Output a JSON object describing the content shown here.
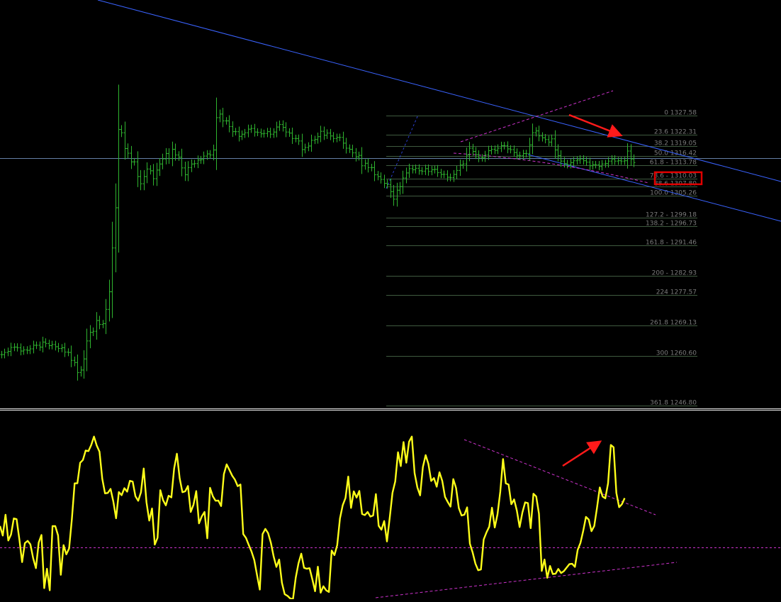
{
  "chart_data": [
    {
      "type": "ohlc",
      "panel": "price",
      "colors": {
        "bars": "#2fb52f",
        "trendlines": "#3a63ff",
        "channel": "#cc33cc",
        "fib_levels": "#3f5a3f",
        "fib_text": "#7a7a7a",
        "price_line": "#7f9fcf",
        "highlight_box": "#e00000",
        "arrow": "#ff1a1a"
      },
      "ylim": [
        1243,
        1335
      ],
      "fib_levels": [
        {
          "label": "0 1327.58",
          "value": 1327.58
        },
        {
          "label": "23.6 1322.31",
          "value": 1322.31
        },
        {
          "label": "38.2 1319.05",
          "value": 1319.05
        },
        {
          "label": "50.0 1316.42",
          "value": 1316.42
        },
        {
          "label": "61.8 - 1313.78",
          "value": 1313.78
        },
        {
          "label": "78.6 - 1310.03",
          "value": 1310.03
        },
        {
          "label": "88.6 1307.80",
          "value": 1307.8
        },
        {
          "label": "100.0 1305.26",
          "value": 1305.26
        },
        {
          "label": "127.2 - 1299.18",
          "value": 1299.18
        },
        {
          "label": "138.2 - 1296.73",
          "value": 1296.73
        },
        {
          "label": "161.8 - 1291.46",
          "value": 1291.46
        },
        {
          "label": "200 - 1282.93",
          "value": 1282.93
        },
        {
          "label": "224 1277.57",
          "value": 1277.57
        },
        {
          "label": "261.8 1269.13",
          "value": 1269.13
        },
        {
          "label": "300 1260.60",
          "value": 1260.6
        },
        {
          "label": "361.8 1246.80",
          "value": 1246.8
        }
      ],
      "highlighted_level": "78.6 - 1310.03",
      "current_price": 1315.7,
      "series_close": [
        1261.0,
        1261.6,
        1261.9,
        1263.0,
        1263.1,
        1262.9,
        1262.0,
        1262.3,
        1262.2,
        1262.6,
        1263.6,
        1263.6,
        1263.1,
        1264.5,
        1264.1,
        1263.5,
        1263.8,
        1263.2,
        1262.7,
        1262.9,
        1261.7,
        1261.6,
        1259.4,
        1258.8,
        1256.0,
        1256.7,
        1259.8,
        1264.8,
        1267.2,
        1267.5,
        1270.5,
        1269.4,
        1269.6,
        1273.6,
        1278.5,
        1290.7,
        1301.9,
        1323.7,
        1322.8,
        1318.4,
        1317.1,
        1314.7,
        1314.7,
        1310.6,
        1308.6,
        1310.6,
        1312.7,
        1312.2,
        1310.0,
        1312.4,
        1314.1,
        1315.5,
        1317.0,
        1315.6,
        1318.2,
        1316.6,
        1316.0,
        1313.0,
        1311.1,
        1313.1,
        1314.1,
        1314.2,
        1315.2,
        1315.3,
        1316.3,
        1316.9,
        1316.6,
        1318.0,
        1327.0,
        1328.0,
        1326.1,
        1326.1,
        1324.5,
        1323.1,
        1323.1,
        1321.8,
        1322.4,
        1322.8,
        1323.8,
        1324.0,
        1323.0,
        1322.9,
        1322.5,
        1322.6,
        1323.1,
        1322.4,
        1323.0,
        1324.4,
        1325.1,
        1324.3,
        1323.0,
        1322.7,
        1321.2,
        1321.2,
        1320.5,
        1318.1,
        1318.7,
        1319.1,
        1320.7,
        1320.9,
        1321.7,
        1323.2,
        1322.1,
        1322.7,
        1321.9,
        1321.2,
        1321.5,
        1321.5,
        1319.9,
        1318.5,
        1318.2,
        1317.2,
        1316.1,
        1316.5,
        1313.6,
        1314.3,
        1313.1,
        1313.1,
        1311.1,
        1310.6,
        1309.8,
        1308.7,
        1308.3,
        1306.4,
        1304.3,
        1306.8,
        1307.8,
        1310.2,
        1311.6,
        1312.8,
        1312.5,
        1312.9,
        1312.2,
        1312.1,
        1312.8,
        1312.0,
        1312.5,
        1312.6,
        1311.7,
        1311.2,
        1311.2,
        1310.4,
        1310.3,
        1311.2,
        1312.3,
        1313.8,
        1314.1,
        1316.6,
        1318.5,
        1317.6,
        1316.7,
        1315.8,
        1315.8,
        1316.6,
        1317.8,
        1318.2,
        1317.9,
        1318.5,
        1319.2,
        1319.2,
        1318.3,
        1318.1,
        1317.3,
        1316.5,
        1316.4,
        1317.0,
        1317.0,
        1319.4,
        1322.8,
        1323.3,
        1321.9,
        1321.4,
        1320.9,
        1320.2,
        1321.1,
        1318.0,
        1316.4,
        1314.9,
        1314.2,
        1313.9,
        1314.5,
        1315.0,
        1315.2,
        1315.5,
        1315.0,
        1314.6,
        1313.6,
        1313.9,
        1313.9,
        1313.4,
        1314.1,
        1314.2,
        1314.9,
        1315.5,
        1314.9,
        1315.0,
        1314.9,
        1315.0,
        1317.7,
        1315.5,
        1314.5
      ]
    },
    {
      "type": "line",
      "panel": "oscillator",
      "colors": {
        "line": "#ffff1a",
        "trendlines": "#cc33cc",
        "arrow": "#ff1a1a",
        "separator": "#e6e6e6"
      },
      "ylim": [
        0,
        100
      ],
      "midline": 28,
      "values": [
        39.7,
        34.5,
        45.8,
        31.8,
        35.1,
        43.8,
        43.4,
        32.5,
        20.1,
        30.4,
        31.6,
        29.7,
        22.2,
        16.8,
        30.7,
        34.8,
        6.0,
        16.5,
        4.8,
        39.6,
        39.6,
        34.6,
        13.2,
        29.3,
        24.3,
        27.5,
        43.4,
        62.8,
        62.9,
        74.0,
        75.5,
        80.6,
        80.3,
        83.6,
        88.2,
        83.3,
        80.0,
        65.3,
        57.4,
        57.6,
        59.8,
        53.0,
        43.9,
        58.1,
        56.4,
        60.2,
        58.3,
        64.2,
        63.8,
        55.8,
        53.4,
        58.0,
        70.9,
        52.5,
        42.6,
        49.2,
        29.6,
        33.3,
        59.1,
        53.7,
        50.9,
        56.1,
        55.2,
        70.9,
        78.9,
        65.6,
        58.0,
        58.5,
        61.4,
        47.3,
        51.2,
        58.6,
        41.1,
        44.9,
        47.3,
        33.0,
        60.4,
        55.8,
        53.4,
        53.5,
        50.5,
        67.8,
        73.1,
        70.1,
        67.0,
        64.8,
        61.3,
        62.2,
        35.3,
        33.2,
        29.4,
        25.8,
        21.2,
        13.0,
        5.2,
        35.3,
        38.1,
        35.8,
        30.6,
        23.2,
        17.5,
        21.5,
        8.9,
        2.7,
        1.8,
        0.4,
        0.0,
        11.7,
        19.5,
        24.7,
        17.0,
        16.5,
        16.8,
        10.8,
        4.3,
        17.6,
        3.5,
        7.0,
        4.8,
        3.9,
        26.4,
        23.9,
        29.3,
        43.8,
        51.0,
        54.9,
        66.5,
        49.5,
        58.5,
        55.1,
        58.7,
        46.2,
        45.6,
        47.3,
        44.8,
        45.4,
        57.0,
        39.8,
        37.7,
        42.4,
        31.3,
        44.1,
        57.7,
        63.9,
        79.7,
        72.2,
        85.2,
        74.0,
        85.4,
        88.2,
        68.4,
        60.6,
        56.3,
        71.7,
        78.1,
        73.3,
        64.1,
        65.7,
        61.0,
        68.8,
        64.2,
        55.5,
        52.7,
        50.2,
        65.1,
        60.3,
        49.4,
        45.4,
        45.8,
        49.8,
        30.1,
        25.3,
        19.3,
        15.7,
        16.1,
        32.4,
        36.2,
        39.3,
        49.6,
        38.9,
        46.1,
        58.3,
        76.0,
        62.8,
        62.2,
        51.5,
        54.1,
        48.0,
        39.1,
        47.0,
        52.5,
        52.1,
        38.5,
        57.2,
        55.7,
        46.3,
        15.3,
        21.5,
        11.6,
        18.0,
        13.6,
        13.8,
        16.4,
        14.2,
        15.2,
        17.1,
        19.0,
        19.2,
        17.5,
        26.7,
        30.5,
        37.0,
        44.6,
        43.2,
        36.9,
        39.7,
        49.6,
        60.6,
        55.7,
        54.7,
        62.9,
        83.6,
        82.4,
        57.6,
        49.9,
        51.5,
        54.8
      ]
    }
  ]
}
